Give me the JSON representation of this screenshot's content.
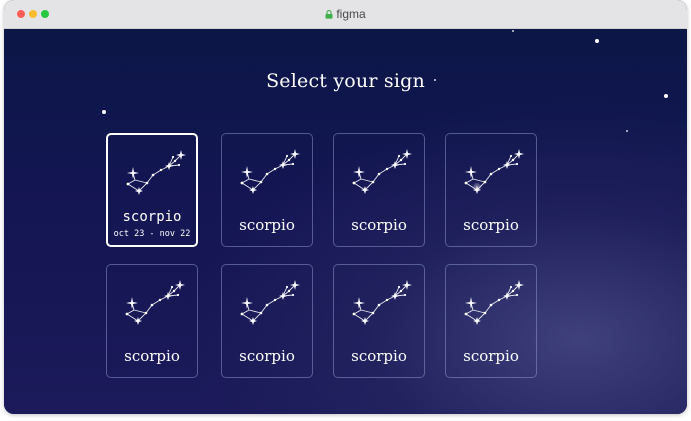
{
  "window": {
    "title": "figma",
    "controls": [
      {
        "name": "close",
        "color": "#ff5f57"
      },
      {
        "name": "minimize",
        "color": "#febc2e"
      },
      {
        "name": "zoom",
        "color": "#28c840"
      }
    ],
    "lock_icon": "lock-icon"
  },
  "page": {
    "heading": "Select your sign"
  },
  "colors": {
    "background_top": "#0b1747",
    "background_bottom": "#1c1a5a",
    "card_border": "#a0aadc",
    "selected_border": "#ffffff"
  },
  "signs": [
    {
      "name": "scorpio",
      "dates": "oct 23 - nov 22",
      "selected": true,
      "icon": "scorpio-constellation-icon"
    },
    {
      "name": "scorpio",
      "selected": false,
      "icon": "scorpio-constellation-icon"
    },
    {
      "name": "scorpio",
      "selected": false,
      "icon": "scorpio-constellation-icon"
    },
    {
      "name": "scorpio",
      "selected": false,
      "icon": "scorpio-constellation-icon"
    },
    {
      "name": "scorpio",
      "selected": false,
      "icon": "scorpio-constellation-icon"
    },
    {
      "name": "scorpio",
      "selected": false,
      "icon": "scorpio-constellation-icon"
    },
    {
      "name": "scorpio",
      "selected": false,
      "icon": "scorpio-constellation-icon"
    },
    {
      "name": "scorpio",
      "selected": false,
      "icon": "scorpio-constellation-icon"
    }
  ]
}
